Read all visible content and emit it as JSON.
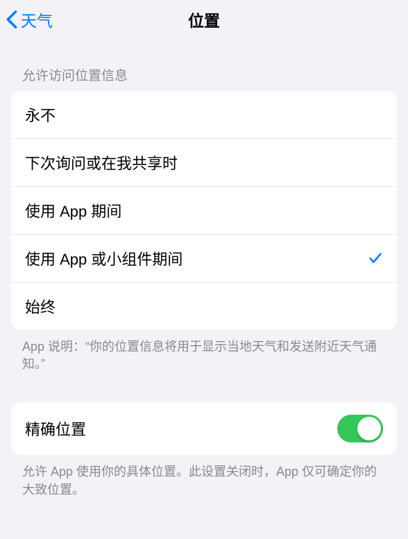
{
  "header": {
    "back_label": "天气",
    "title": "位置"
  },
  "section1": {
    "header": "允许访问位置信息",
    "options": [
      {
        "label": "永不",
        "selected": false
      },
      {
        "label": "下次询问或在我共享时",
        "selected": false
      },
      {
        "label": "使用 App 期间",
        "selected": false
      },
      {
        "label": "使用 App 或小组件期间",
        "selected": true
      },
      {
        "label": "始终",
        "selected": false
      }
    ],
    "footer": "App 说明：“你的位置信息将用于显示当地天气和发送附近天气通知。”"
  },
  "section2": {
    "precise_label": "精确位置",
    "precise_on": true,
    "footer": "允许 App 使用你的具体位置。此设置关闭时，App 仅可确定你的大致位置。"
  }
}
